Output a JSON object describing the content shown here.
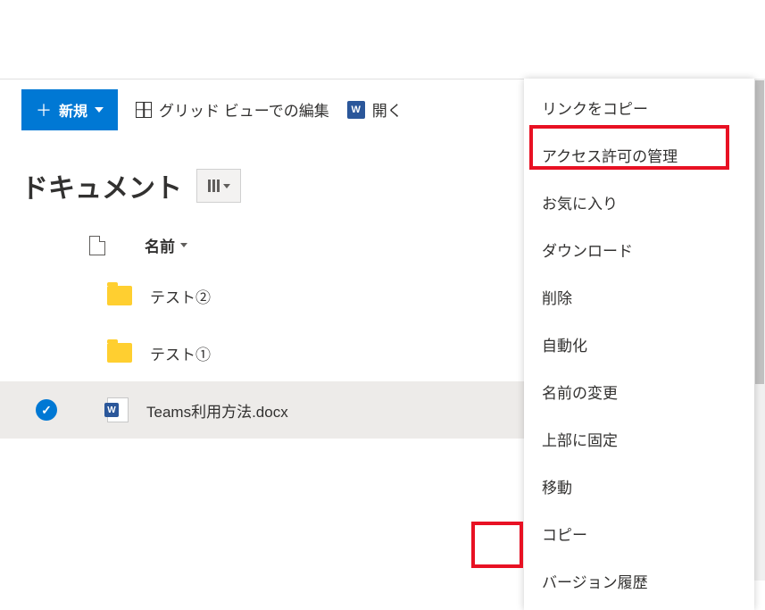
{
  "toolbar": {
    "new_button": "新規",
    "grid_edit": "グリッド ビューでの編集",
    "open": "開く"
  },
  "page": {
    "title": "ドキュメント"
  },
  "columns": {
    "name": "名前"
  },
  "items": [
    {
      "name": "テスト②",
      "type": "folder"
    },
    {
      "name": "テスト①",
      "type": "folder"
    },
    {
      "name": "Teams利用方法.docx",
      "type": "docx",
      "selected": true
    }
  ],
  "context_menu": {
    "items": [
      "リンクをコピー",
      "アクセス許可の管理",
      "お気に入り",
      "ダウンロード",
      "削除",
      "自動化",
      "名前の変更",
      "上部に固定",
      "移動",
      "コピー",
      "バージョン履歴"
    ]
  }
}
